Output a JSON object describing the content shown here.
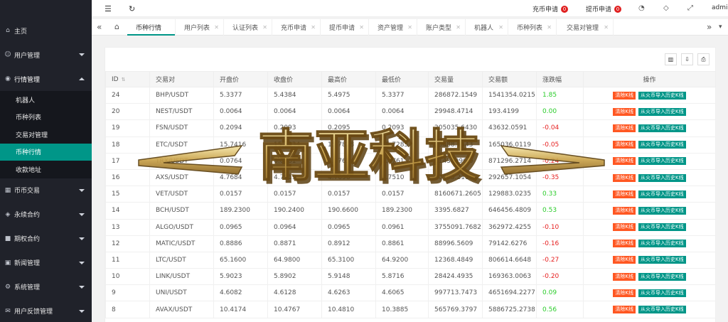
{
  "sidebar": {
    "items": [
      {
        "label": "主页",
        "icon": "home-icon"
      },
      {
        "label": "用户管理",
        "icon": "user-icon"
      },
      {
        "label": "行情管理",
        "icon": "market-icon"
      },
      {
        "label": "币币交易",
        "icon": "exchange-icon"
      },
      {
        "label": "永续合约",
        "icon": "contract-icon"
      },
      {
        "label": "期权合约",
        "icon": "option-icon"
      },
      {
        "label": "新闻管理",
        "icon": "news-icon"
      },
      {
        "label": "系统管理",
        "icon": "gear-icon"
      },
      {
        "label": "用户反馈管理",
        "icon": "feedback-icon"
      }
    ],
    "submenu": [
      {
        "label": "机器人"
      },
      {
        "label": "币种列表"
      },
      {
        "label": "交易对管理"
      },
      {
        "label": "币种行情"
      },
      {
        "label": "收款地址"
      }
    ]
  },
  "header": {
    "recharge_label": "充币申请",
    "recharge_count": "0",
    "withdraw_label": "提币申请",
    "withdraw_count": "0",
    "user": "admin"
  },
  "tabs": [
    {
      "label": "币种行情"
    },
    {
      "label": "用户列表"
    },
    {
      "label": "认证列表"
    },
    {
      "label": "充币申请"
    },
    {
      "label": "提币申请"
    },
    {
      "label": "资产管理"
    },
    {
      "label": "账户类型"
    },
    {
      "label": "机器人"
    },
    {
      "label": "币种列表"
    },
    {
      "label": "交易对管理"
    }
  ],
  "table": {
    "headers": [
      "ID",
      "交易对",
      "开盘价",
      "收盘价",
      "最高价",
      "最低价",
      "交易量",
      "交易额",
      "涨跌幅",
      "操作"
    ],
    "clear_label": "清除K线",
    "import_label": "从火币导入历史K线",
    "rows": [
      {
        "id": "24",
        "pair": "BHP/USDT",
        "open": "5.3377",
        "close": "5.4384",
        "high": "5.4975",
        "low": "5.3377",
        "volume": "286872.1549",
        "amount": "1541354.0215",
        "change": "1.85",
        "dir": "pos"
      },
      {
        "id": "20",
        "pair": "NEST/USDT",
        "open": "0.0064",
        "close": "0.0064",
        "high": "0.0064",
        "low": "0.0064",
        "volume": "29948.4714",
        "amount": "193.4199",
        "change": "0.00",
        "dir": "pos"
      },
      {
        "id": "19",
        "pair": "FSN/USDT",
        "open": "0.2094",
        "close": "0.2093",
        "high": "0.2095",
        "low": "0.2093",
        "volume": "205035.6430",
        "amount": "43632.0591",
        "change": "-0.04",
        "dir": "neg"
      },
      {
        "id": "18",
        "pair": "ETC/USDT",
        "open": "15.7416",
        "close": "15.7334",
        "high": "15.7828",
        "low": "15.7285",
        "volume": "10488.1543",
        "amount": "165036.0119",
        "change": "-0.05",
        "dir": "neg"
      },
      {
        "id": "17",
        "pair": "TRX/USDT",
        "open": "0.0764",
        "close": "0.0761",
        "high": "0.0765",
        "low": "0.0761",
        "volume": "11436996.0",
        "amount": "871296.2714",
        "change": "-0.24",
        "dir": "neg"
      },
      {
        "id": "16",
        "pair": "AXS/USDT",
        "open": "4.7684",
        "close": "4.7519",
        "high": "4.7696",
        "low": "4.7510",
        "volume": "60563.2119",
        "amount": "292657.1054",
        "change": "-0.35",
        "dir": "neg"
      },
      {
        "id": "15",
        "pair": "VET/USDT",
        "open": "0.0157",
        "close": "0.0157",
        "high": "0.0157",
        "low": "0.0157",
        "volume": "8160671.2605",
        "amount": "129883.0235",
        "change": "0.33",
        "dir": "pos"
      },
      {
        "id": "14",
        "pair": "BCH/USDT",
        "open": "189.2300",
        "close": "190.2400",
        "high": "190.6600",
        "low": "189.2300",
        "volume": "3395.6827",
        "amount": "646456.4809",
        "change": "0.53",
        "dir": "pos"
      },
      {
        "id": "13",
        "pair": "ALGO/USDT",
        "open": "0.0965",
        "close": "0.0964",
        "high": "0.0965",
        "low": "0.0961",
        "volume": "3755091.7682",
        "amount": "362972.4255",
        "change": "-0.10",
        "dir": "neg"
      },
      {
        "id": "12",
        "pair": "MATIC/USDT",
        "open": "0.8886",
        "close": "0.8871",
        "high": "0.8912",
        "low": "0.8861",
        "volume": "88996.5609",
        "amount": "79142.6276",
        "change": "-0.16",
        "dir": "neg"
      },
      {
        "id": "11",
        "pair": "LTC/USDT",
        "open": "65.1600",
        "close": "64.9800",
        "high": "65.3100",
        "low": "64.9200",
        "volume": "12368.4849",
        "amount": "806614.6648",
        "change": "-0.27",
        "dir": "neg"
      },
      {
        "id": "10",
        "pair": "LINK/USDT",
        "open": "5.9023",
        "close": "5.8902",
        "high": "5.9148",
        "low": "5.8716",
        "volume": "28424.4935",
        "amount": "169363.0063",
        "change": "-0.20",
        "dir": "neg"
      },
      {
        "id": "9",
        "pair": "UNI/USDT",
        "open": "4.6082",
        "close": "4.6128",
        "high": "4.6263",
        "low": "4.6065",
        "volume": "997713.7473",
        "amount": "4651694.2277",
        "change": "0.09",
        "dir": "pos"
      },
      {
        "id": "8",
        "pair": "AVAX/USDT",
        "open": "10.4174",
        "close": "10.4767",
        "high": "10.4810",
        "low": "10.3885",
        "volume": "565769.3797",
        "amount": "5886725.2738",
        "change": "0.56",
        "dir": "pos"
      }
    ]
  },
  "watermark": {
    "text": "南亚科技"
  },
  "colors": {
    "sidebar": "#20222a",
    "accent": "#009688",
    "danger": "#ff5722",
    "up": "#2bcc2b",
    "down": "#e62020"
  }
}
